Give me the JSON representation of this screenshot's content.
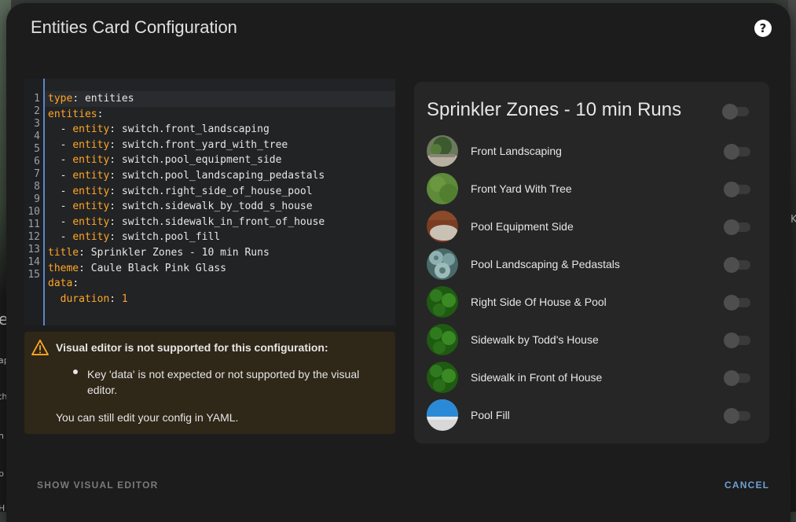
{
  "background": {
    "left_text": [
      "e",
      "ap",
      "th",
      "n",
      "p",
      "H"
    ],
    "right_text": "K"
  },
  "dialog": {
    "title": "Entities Card Configuration",
    "help_icon": "help-circle-icon"
  },
  "editor": {
    "line_numbers": [
      "1",
      "2",
      "3",
      "4",
      "5",
      "6",
      "7",
      "8",
      "9",
      "10",
      "11",
      "12",
      "13",
      "14",
      "15"
    ],
    "lines": [
      {
        "key": "type",
        "value": " entities",
        "indent": ""
      },
      {
        "key": "entities",
        "value": "",
        "indent": ""
      },
      {
        "key": "entity",
        "value": " switch.front_landscaping",
        "indent": "  - "
      },
      {
        "key": "entity",
        "value": " switch.front_yard_with_tree",
        "indent": "  - "
      },
      {
        "key": "entity",
        "value": " switch.pool_equipment_side",
        "indent": "  - "
      },
      {
        "key": "entity",
        "value": " switch.pool_landscaping_pedastals",
        "indent": "  - "
      },
      {
        "key": "entity",
        "value": " switch.right_side_of_house_pool",
        "indent": "  - "
      },
      {
        "key": "entity",
        "value": " switch.sidewalk_by_todd_s_house",
        "indent": "  - "
      },
      {
        "key": "entity",
        "value": " switch.sidewalk_in_front_of_house",
        "indent": "  - "
      },
      {
        "key": "entity",
        "value": " switch.pool_fill",
        "indent": "  - "
      },
      {
        "key": "title",
        "value": " Sprinkler Zones - 10 min Runs",
        "indent": ""
      },
      {
        "key": "theme",
        "value": " Caule Black Pink Glass",
        "indent": ""
      },
      {
        "key": "data",
        "value": "",
        "indent": ""
      },
      {
        "key": "duration",
        "value": " 1",
        "indent": "  ",
        "numeric": true
      }
    ]
  },
  "warning": {
    "title": "Visual editor is not supported for this configuration:",
    "item": "Key 'data' is not expected or not supported by the visual editor.",
    "footer": "You can still edit your config in YAML."
  },
  "card": {
    "title": "Sprinkler Zones - 10 min Runs",
    "rows": [
      {
        "label": "Front Landscaping",
        "avatar": "landscaping"
      },
      {
        "label": "Front Yard With Tree",
        "avatar": "grass"
      },
      {
        "label": "Pool Equipment Side",
        "avatar": "pool-equipment"
      },
      {
        "label": "Pool Landscaping & Pedastals",
        "avatar": "succulent"
      },
      {
        "label": "Right Side Of House & Pool",
        "avatar": "shrub"
      },
      {
        "label": "Sidewalk by Todd's House",
        "avatar": "shrub"
      },
      {
        "label": "Sidewalk in Front of House",
        "avatar": "shrub"
      },
      {
        "label": "Pool Fill",
        "avatar": "pool-water"
      }
    ]
  },
  "footer": {
    "left_button": "SHOW VISUAL EDITOR",
    "right_button": "CANCEL"
  },
  "colors": {
    "accent": "#6e9fd8",
    "warning": "#ffa726",
    "code_key": "#ffa726",
    "disabled_text": "#7a7a7a"
  }
}
